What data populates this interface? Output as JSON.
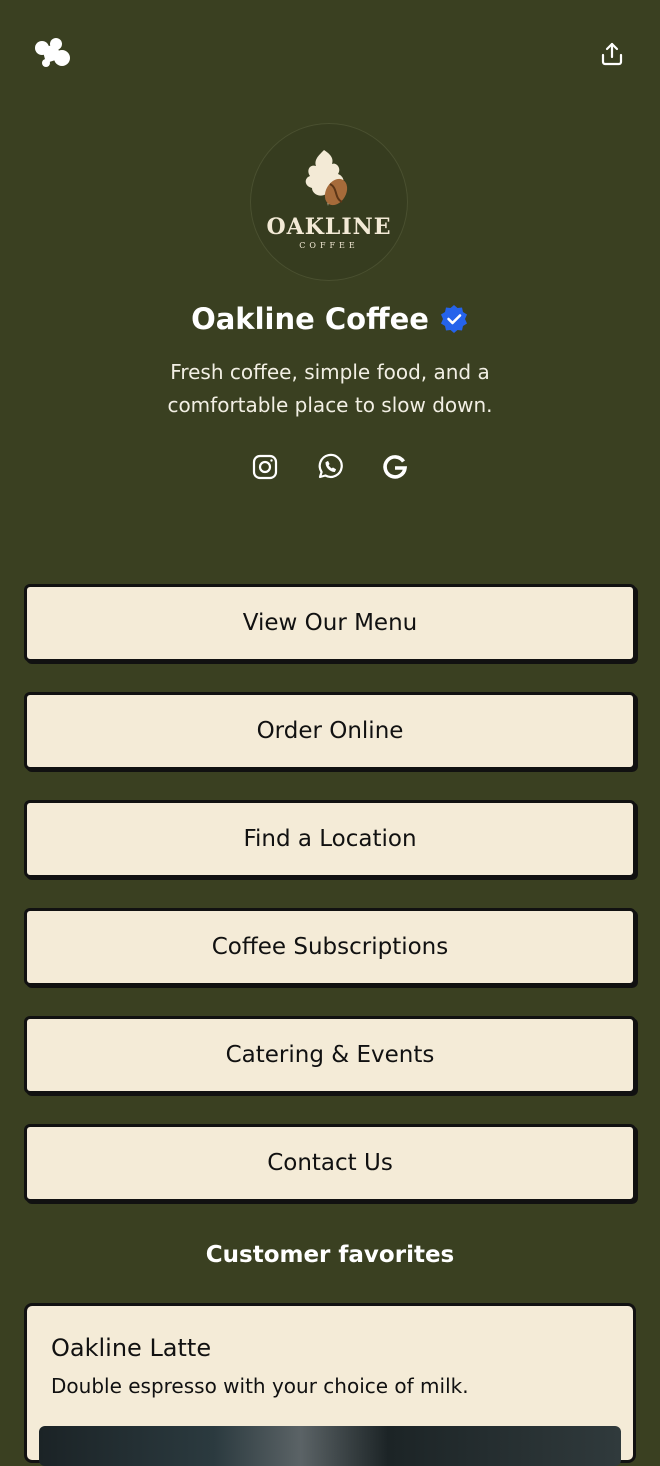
{
  "header": {
    "brand_icon": "brand-logo-icon",
    "share_icon": "share-icon"
  },
  "profile": {
    "logo_wordmark": "OAKLINE",
    "logo_sub": "COFFEE",
    "name": "Oakline Coffee",
    "verified_icon": "verified-badge-icon",
    "verified_color": "#2563eb",
    "bio": "Fresh coffee, simple food, and a comfortable place to slow down."
  },
  "socials": [
    {
      "icon": "instagram-icon"
    },
    {
      "icon": "whatsapp-icon"
    },
    {
      "icon": "google-icon"
    }
  ],
  "links": [
    {
      "label": "View Our Menu"
    },
    {
      "label": "Order Online"
    },
    {
      "label": "Find a Location"
    },
    {
      "label": "Coffee Subscriptions"
    },
    {
      "label": "Catering & Events"
    },
    {
      "label": "Contact Us"
    }
  ],
  "favorites": {
    "title": "Customer favorites",
    "items": [
      {
        "name": "Oakline Latte",
        "description": "Double espresso with your choice of milk."
      }
    ]
  },
  "theme": {
    "background": "#3a4021",
    "button_bg": "#f4ebd7",
    "button_border": "#111111"
  }
}
